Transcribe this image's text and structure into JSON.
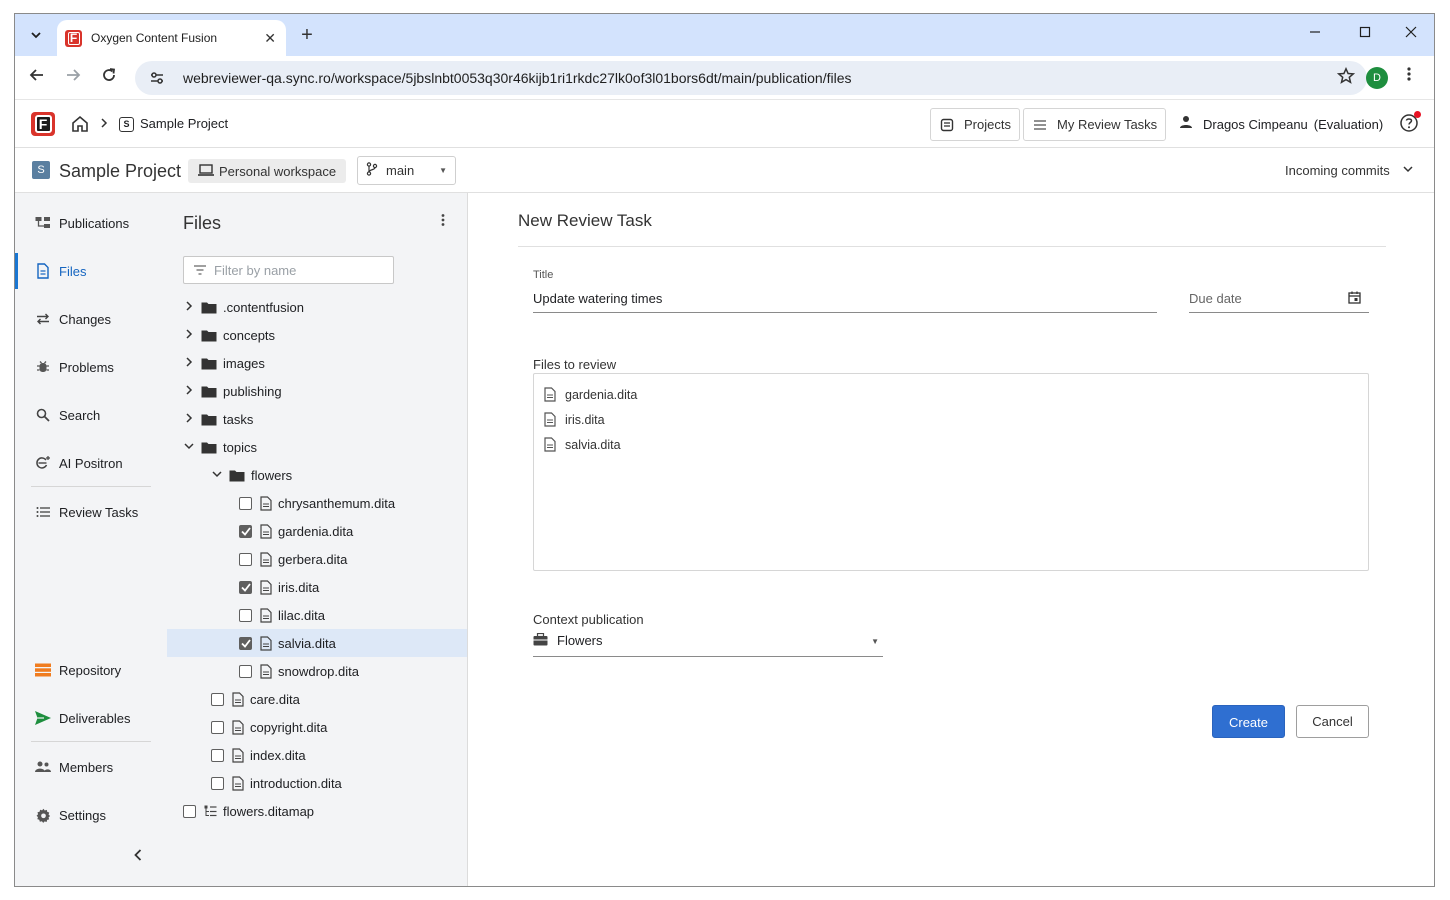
{
  "browser": {
    "tab_title": "Oxygen Content Fusion",
    "url": "webreviewer-qa.sync.ro/workspace/5jbslnbt0053q30r46kijb1ri1rkdc27lk0of3l01bors6dt/main/publication/files",
    "profile_initial": "D",
    "new_tab_label": "+",
    "close_tab_label": "✕"
  },
  "header": {
    "breadcrumb_project": "Sample Project",
    "projects_label": "Projects",
    "my_review_tasks_label": "My Review Tasks",
    "user_name": "Dragos Cimpeanu",
    "user_status": "(Evaluation)"
  },
  "project_bar": {
    "avatar_letter": "S",
    "title": "Sample Project",
    "workspace_label": "Personal workspace",
    "branch": "main",
    "incoming_commits": "Incoming commits"
  },
  "sidebar": {
    "items": [
      {
        "label": "Publications",
        "icon": "publications-icon"
      },
      {
        "label": "Files",
        "icon": "file-icon",
        "active": true
      },
      {
        "label": "Changes",
        "icon": "changes-icon"
      },
      {
        "label": "Problems",
        "icon": "bug-icon"
      },
      {
        "label": "Search",
        "icon": "search-icon"
      },
      {
        "label": "AI Positron",
        "icon": "ai-positron-icon"
      },
      {
        "label": "Review Tasks",
        "icon": "list-icon"
      },
      {
        "label": "Repository",
        "icon": "repository-icon"
      },
      {
        "label": "Deliverables",
        "icon": "send-icon"
      },
      {
        "label": "Members",
        "icon": "members-icon"
      },
      {
        "label": "Settings",
        "icon": "gear-icon"
      }
    ]
  },
  "files_panel": {
    "title": "Files",
    "filter_placeholder": "Filter by name",
    "tree": [
      {
        "name": ".contentfusion",
        "type": "folder",
        "expanded": false,
        "level": 0
      },
      {
        "name": "concepts",
        "type": "folder",
        "expanded": false,
        "level": 0
      },
      {
        "name": "images",
        "type": "folder",
        "expanded": false,
        "level": 0
      },
      {
        "name": "publishing",
        "type": "folder",
        "expanded": false,
        "level": 0
      },
      {
        "name": "tasks",
        "type": "folder",
        "expanded": false,
        "level": 0
      },
      {
        "name": "topics",
        "type": "folder",
        "expanded": true,
        "level": 0
      },
      {
        "name": "flowers",
        "type": "folder",
        "expanded": true,
        "level": 1
      },
      {
        "name": "chrysanthemum.dita",
        "type": "file",
        "checked": false,
        "level": 2
      },
      {
        "name": "gardenia.dita",
        "type": "file",
        "checked": true,
        "level": 2
      },
      {
        "name": "gerbera.dita",
        "type": "file",
        "checked": false,
        "level": 2
      },
      {
        "name": "iris.dita",
        "type": "file",
        "checked": true,
        "level": 2
      },
      {
        "name": "lilac.dita",
        "type": "file",
        "checked": false,
        "level": 2
      },
      {
        "name": "salvia.dita",
        "type": "file",
        "checked": true,
        "level": 2,
        "selected": true
      },
      {
        "name": "snowdrop.dita",
        "type": "file",
        "checked": false,
        "level": 2
      },
      {
        "name": "care.dita",
        "type": "file",
        "checked": false,
        "level": 1
      },
      {
        "name": "copyright.dita",
        "type": "file",
        "checked": false,
        "level": 1
      },
      {
        "name": "index.dita",
        "type": "file",
        "checked": false,
        "level": 1
      },
      {
        "name": "introduction.dita",
        "type": "file",
        "checked": false,
        "level": 1
      },
      {
        "name": "flowers.ditamap",
        "type": "map",
        "checked": false,
        "level": 0
      }
    ]
  },
  "review_task": {
    "heading": "New Review Task",
    "title_label": "Title",
    "title_value": "Update watering times",
    "due_date_placeholder": "Due date",
    "files_label": "Files to review",
    "files": [
      "gardenia.dita",
      "iris.dita",
      "salvia.dita"
    ],
    "context_label": "Context publication",
    "context_value": "Flowers",
    "create_label": "Create",
    "cancel_label": "Cancel"
  },
  "colors": {
    "accent": "#2f6fd1",
    "brand": "#d9342b",
    "nav_bg": "#f3f4f6",
    "selected_row": "#dde8f7"
  }
}
